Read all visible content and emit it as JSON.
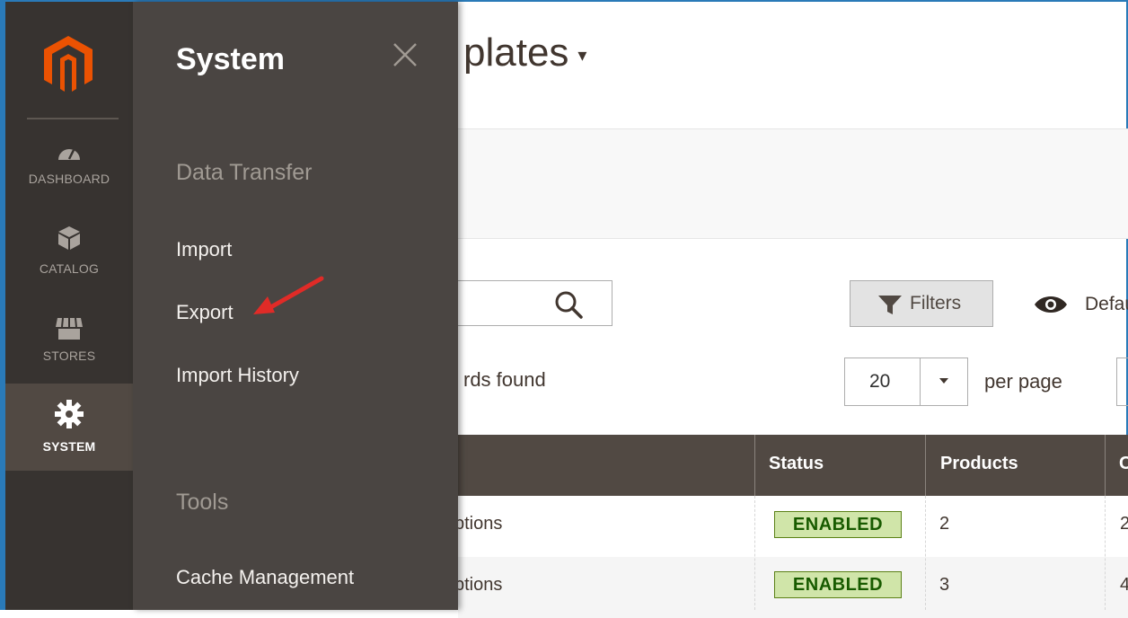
{
  "admin_nav": {
    "items": [
      {
        "label": "DASHBOARD",
        "icon": "gauge-icon"
      },
      {
        "label": "CATALOG",
        "icon": "box-icon"
      },
      {
        "label": "STORES",
        "icon": "shop-icon"
      },
      {
        "label": "SYSTEM",
        "icon": "gear-icon",
        "active": true
      }
    ]
  },
  "flyout": {
    "title": "System",
    "sections": [
      {
        "heading": "Data Transfer",
        "links": [
          "Import",
          "Export",
          "Import History"
        ]
      },
      {
        "heading": "Tools",
        "links": [
          "Cache Management"
        ]
      }
    ]
  },
  "page": {
    "title_partial": "plates",
    "filters_label": "Filters",
    "view_partial": "Defau",
    "records_partial": "rds found",
    "per_page_value": "20",
    "per_page_label": "per page"
  },
  "grid": {
    "columns": [
      "Status",
      "Products",
      "C"
    ],
    "rows": [
      {
        "name_partial": "ptions",
        "status": "ENABLED",
        "products": "2",
        "next": "2"
      },
      {
        "name_partial": "ptions",
        "status": "ENABLED",
        "products": "3",
        "next": "4"
      }
    ]
  },
  "colors": {
    "nav_bg": "#373330",
    "flyout_bg": "#4a4542",
    "logo_orange": "#eb5202",
    "annotation_arrow": "#e02b27"
  }
}
